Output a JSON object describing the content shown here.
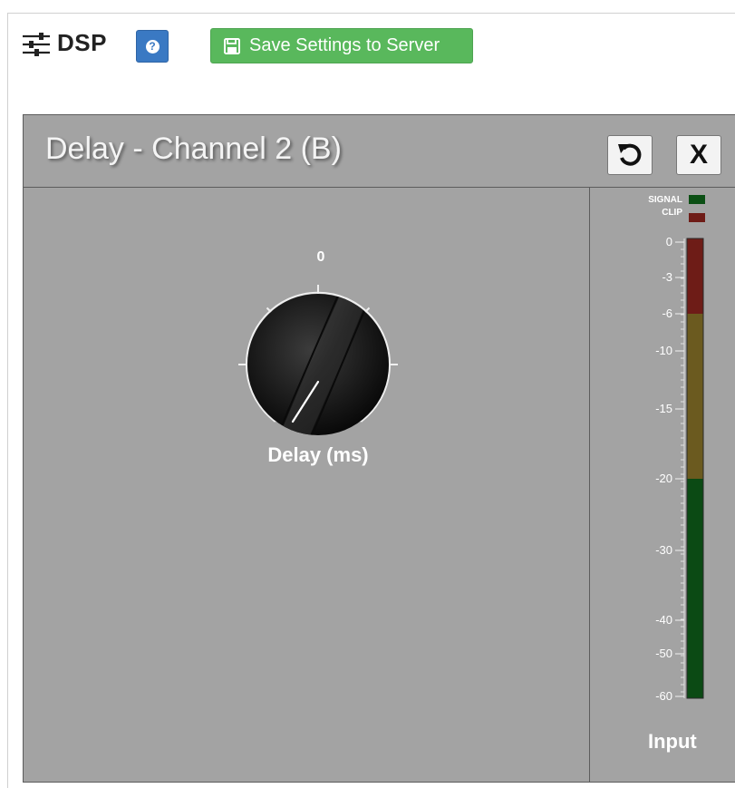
{
  "toolbar": {
    "title": "DSP",
    "help_glyph": "?",
    "save_label": "Save Settings to Server"
  },
  "panel": {
    "title": "Delay - Channel 2 (B)",
    "close_label": "X"
  },
  "knob": {
    "value_text": "0",
    "label": "Delay (ms)",
    "value": 0
  },
  "meter": {
    "label": "Input",
    "signal_label": "SIGNAL",
    "clip_label": "CLIP",
    "scale": [
      "0",
      "-3",
      "-6",
      "-10",
      "-15",
      "-20",
      "-30",
      "-40",
      "-50",
      "-60"
    ],
    "colors": {
      "signal": "#0b4f14",
      "clip": "#6e1c17",
      "green": "#0b4a14",
      "yellow": "#6b5a1f",
      "red": "#6e1c17"
    }
  },
  "colors": {
    "panel_bg": "#a3a3a3",
    "save_green": "#59b85c",
    "help_blue": "#3a79c3"
  }
}
